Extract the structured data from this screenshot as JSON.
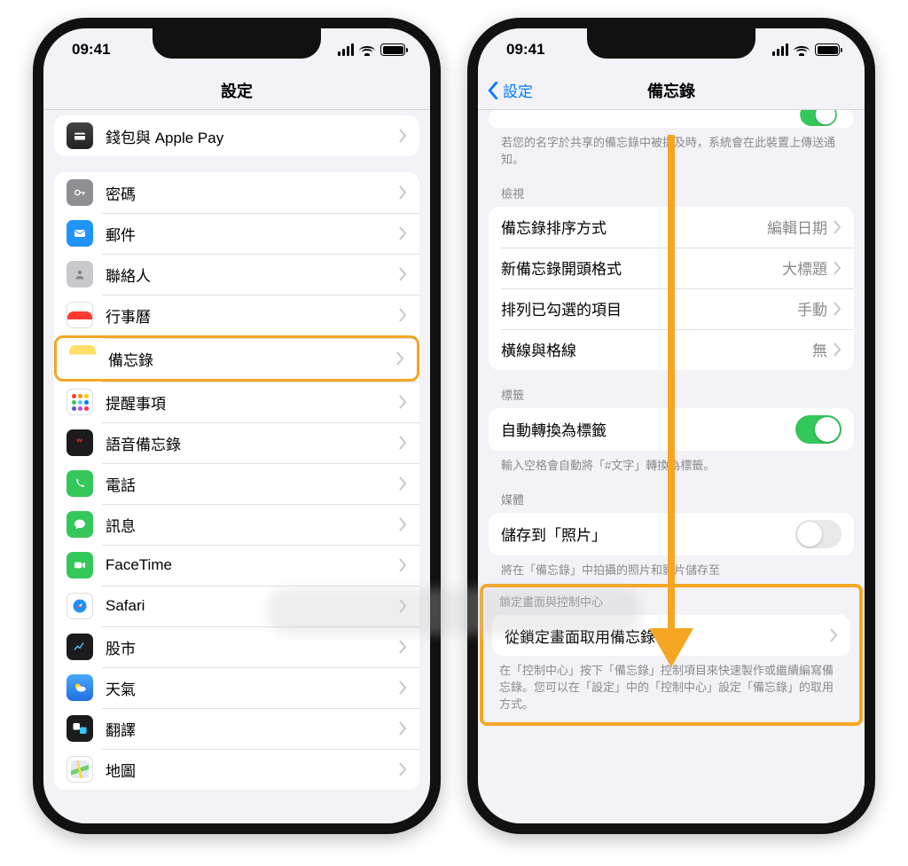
{
  "status": {
    "time": "09:41"
  },
  "left": {
    "title": "設定",
    "group1": [
      {
        "key": "wallet",
        "label": "錢包與 Apple Pay"
      }
    ],
    "group2": [
      {
        "key": "passwords",
        "label": "密碼"
      },
      {
        "key": "mail",
        "label": "郵件"
      },
      {
        "key": "contacts",
        "label": "聯絡人"
      },
      {
        "key": "calendar",
        "label": "行事曆"
      },
      {
        "key": "notes",
        "label": "備忘錄",
        "highlight": true
      },
      {
        "key": "reminders",
        "label": "提醒事項"
      },
      {
        "key": "voicememos",
        "label": "語音備忘錄"
      },
      {
        "key": "phone",
        "label": "電話"
      },
      {
        "key": "messages",
        "label": "訊息"
      },
      {
        "key": "facetime",
        "label": "FaceTime"
      },
      {
        "key": "safari",
        "label": "Safari"
      },
      {
        "key": "stocks",
        "label": "股市"
      },
      {
        "key": "weather",
        "label": "天氣"
      },
      {
        "key": "translate",
        "label": "翻譯"
      },
      {
        "key": "maps",
        "label": "地圖"
      }
    ]
  },
  "right": {
    "back": "設定",
    "title": "備忘錄",
    "mention_footer": "若您的名字於共享的備忘錄中被提及時，系統會在此裝置上傳送通知。",
    "view_header": "檢視",
    "view_rows": {
      "sort": {
        "label": "備忘錄排序方式",
        "value": "編輯日期"
      },
      "start": {
        "label": "新備忘錄開頭格式",
        "value": "大標題"
      },
      "checked": {
        "label": "排列已勾選的項目",
        "value": "手動"
      },
      "lines": {
        "label": "橫線與格線",
        "value": "無"
      }
    },
    "tags_header": "標籤",
    "tags_row_label": "自動轉換為標籤",
    "tags_footer": "輸入空格會自動將「#文字」轉換為標籤。",
    "media_header": "媒體",
    "media_row_label": "儲存到「照片」",
    "media_footer": "將在「備忘錄」中拍攝的照片和影片儲存至",
    "lock_header": "鎖定畫面與控制中心",
    "lock_row_label": "從鎖定畫面取用備忘錄",
    "lock_footer": "在「控制中心」按下「備忘錄」控制項目來快速製作或繼續編寫備忘錄。您可以在「設定」中的「控制中心」設定「備忘錄」的取用方式。"
  }
}
